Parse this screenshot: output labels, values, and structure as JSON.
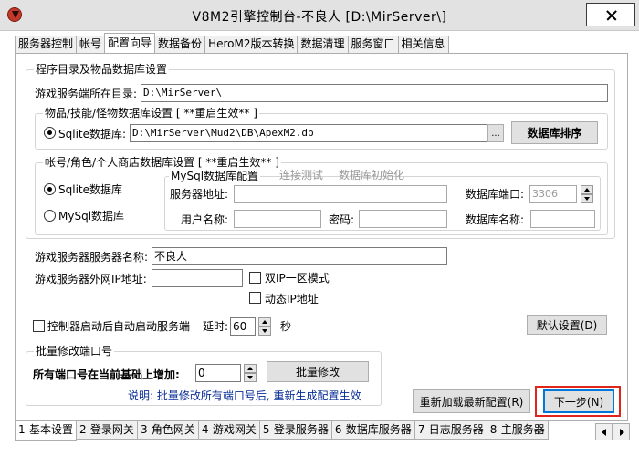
{
  "window": {
    "title": "V8M2引擎控制台-不良人 [D:\\MirServer\\]",
    "minimize_label": "—",
    "close_label": "✕"
  },
  "top_tabs": [
    "服务器控制",
    "帐号",
    "配置向导",
    "数据备份",
    "HeroM2版本转换",
    "数据清理",
    "服务窗口",
    "相关信息"
  ],
  "paths_group": {
    "title": "程序目录及物品数据库设置",
    "game_dir_label": "游戏服务端所在目录:",
    "game_dir_value": "D:\\MirServer\\",
    "item_db_group_title": "物品/技能/怪物数据库设置 [ **重启生效** ]",
    "sqlite_label": "Sqlite数据库:",
    "sqlite_path": "D:\\MirServer\\Mud2\\DB\\ApexM2.db",
    "browse_label": "...",
    "db_sort_button": "数据库排序"
  },
  "account_db": {
    "title": "帐号/角色/个人商店数据库设置  [ **重启生效** ]",
    "sqlite_radio": "Sqlite数据库",
    "mysql_radio": "MySql数据库",
    "mysql_group_title": "MySql数据库配置",
    "test_connection": "连接测试",
    "init_db": "数据库初始化",
    "server_address_label": "服务器地址:",
    "db_port_label": "数据库端口:",
    "db_port_value": "3306",
    "username_label": "用户名称:",
    "password_label": "密码:",
    "db_name_label": "数据库名称:"
  },
  "server_settings": {
    "server_name_label": "游戏服务器服务器名称:",
    "server_name_value": "不良人",
    "ip_label": "游戏服务器外网IP地址:",
    "dual_ip_label": "双IP一区模式",
    "dynamic_ip_label": "动态IP地址",
    "autostart_label": "控制器启动后自动启动服务端",
    "delay_label": "延时:",
    "delay_value": "60",
    "seconds_label": "秒",
    "default_settings_button": "默认设置(D)"
  },
  "port_group": {
    "title": "批量修改端口号",
    "increase_label": "所有端口号在当前基础上增加:",
    "increase_value": "0",
    "batch_modify_button": "批量修改",
    "note": "说明: 批量修改所有端口号后, 重新生成配置生效"
  },
  "actions": {
    "reload_button": "重新加载最新配置(R)",
    "next_button": "下一步(N)"
  },
  "bottom_tabs": [
    "1-基本设置",
    "2-登录网关",
    "3-角色网关",
    "4-游戏网关",
    "5-登录服务器",
    "6-数据库服务器",
    "7-日志服务器",
    "8-主服务器"
  ]
}
